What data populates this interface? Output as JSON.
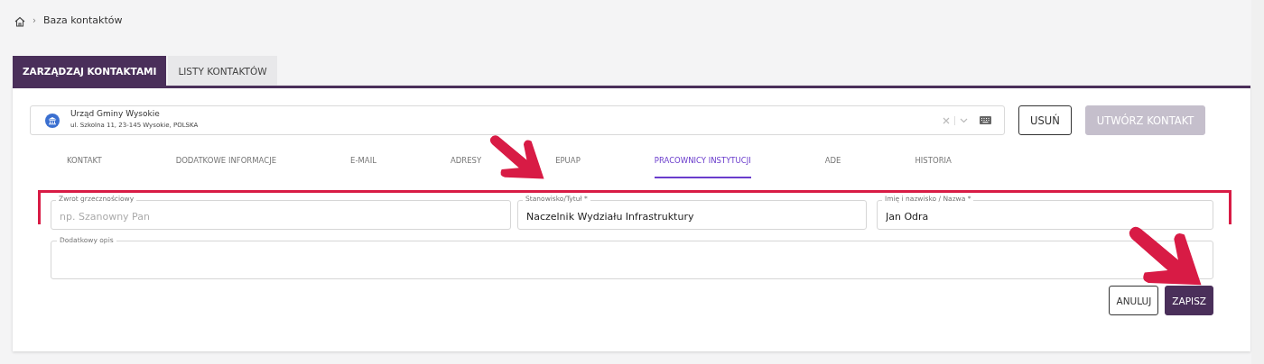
{
  "breadcrumb": {
    "separator": "›",
    "items": [
      "Baza kontaktów"
    ]
  },
  "main_tabs": [
    {
      "label": "ZARZĄDZAJ KONTAKTAMI",
      "selected": true
    },
    {
      "label": "LISTY KONTAKTÓW",
      "selected": false
    }
  ],
  "contact_select": {
    "name": "Urząd Gminy Wysokie",
    "address": "ul. Szkolna 11, 23-145 Wysokie, POLSKA"
  },
  "contact_buttons": [
    {
      "label": "USUŃ",
      "kind": "outline",
      "disabled": false
    },
    {
      "label": "UTWÓRZ KONTAKT",
      "kind": "filled",
      "disabled": true
    }
  ],
  "sub_tabs": [
    {
      "label": "KONTAKT",
      "selected": false
    },
    {
      "label": "DODATKOWE INFORMACJE",
      "selected": false
    },
    {
      "label": "E-MAIL",
      "selected": false
    },
    {
      "label": "ADRESY",
      "selected": false
    },
    {
      "label": "EPUAP",
      "selected": false
    },
    {
      "label": "PRACOWNICY INSTYTUCJI",
      "selected": true
    },
    {
      "label": "ADE",
      "selected": false
    },
    {
      "label": "HISTORIA",
      "selected": false
    }
  ],
  "form": {
    "fields": [
      {
        "label": "Zwrot grzecznościowy",
        "placeholder": "np. Szanowny Pan"
      },
      {
        "label": "Stanowisko/Tytuł *",
        "value": "Naczelnik Wydziału Infrastruktury"
      },
      {
        "label": "Imię i nazwisko / Nazwa *",
        "value": "Jan Odra"
      }
    ],
    "description": {
      "label": "Dodatkowy opis"
    },
    "buttons": [
      {
        "label": "ANULUJ",
        "kind": "outline",
        "disabled": false
      },
      {
        "label": "ZAPISZ",
        "kind": "filled",
        "disabled": false
      }
    ]
  }
}
